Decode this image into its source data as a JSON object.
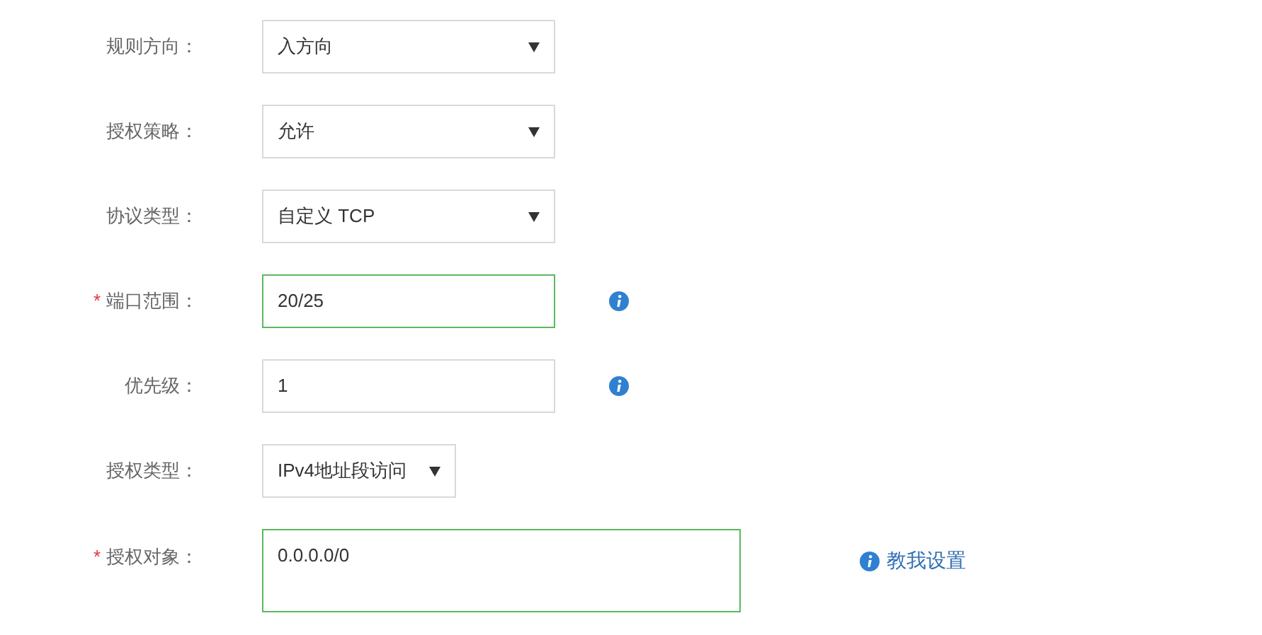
{
  "form": {
    "rows": [
      {
        "label": "规则方向：",
        "kind": "select",
        "value": "入方向",
        "valid": false
      },
      {
        "label": "授权策略：",
        "kind": "select",
        "value": "允许",
        "valid": false
      },
      {
        "label": "协议类型：",
        "kind": "select",
        "value": "自定义 TCP",
        "valid": false
      },
      {
        "required_mark": "*",
        "label": "端口范围：",
        "kind": "input",
        "value": "20/25",
        "valid": true,
        "info": true
      },
      {
        "label": "优先级：",
        "kind": "input",
        "value": "1",
        "valid": false,
        "info": true
      },
      {
        "label": "授权类型：",
        "kind": "compact-select",
        "value": "IPv4地址段访问",
        "valid": false
      },
      {
        "required_mark": "*",
        "label": "授权对象：",
        "kind": "textarea",
        "value": "0.0.0.0/0",
        "valid": true,
        "help": "教我设置"
      }
    ]
  }
}
